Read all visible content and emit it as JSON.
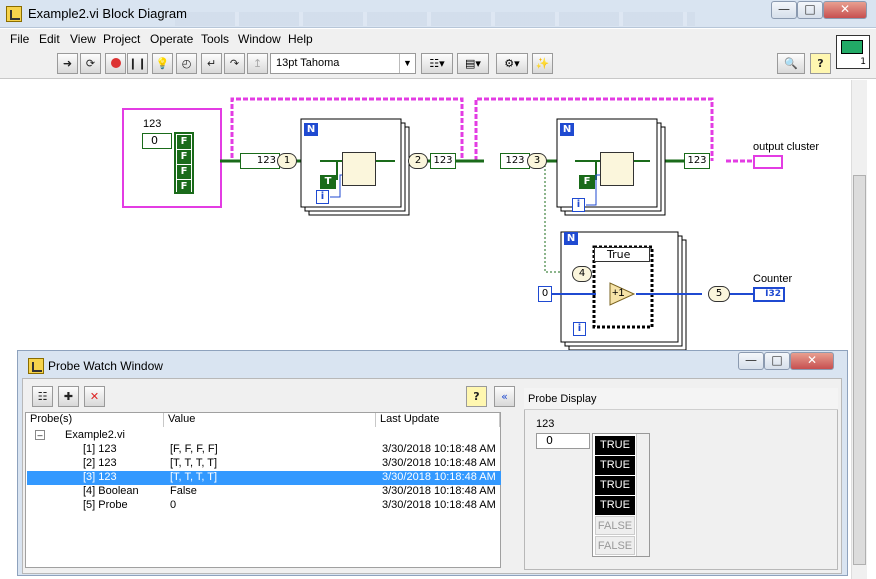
{
  "window": {
    "title": "Example2.vi Block Diagram"
  },
  "menu": [
    "File",
    "Edit",
    "View",
    "Project",
    "Operate",
    "Tools",
    "Window",
    "Help"
  ],
  "toolbar": {
    "font": "13pt Tahoma"
  },
  "diagram": {
    "array_label": "123",
    "array_index": "0",
    "array_elements": [
      "F",
      "F",
      "F",
      "F"
    ],
    "loop1": {
      "count_label": "N",
      "tunnel_value": "123",
      "shift_label": "1",
      "out_label": "2",
      "bool_const": "T",
      "iter": "i"
    },
    "loop2": {
      "count_label": "N",
      "tunnel_value": "123",
      "shift_label": "3",
      "bool_const": "F",
      "iter": "i"
    },
    "loop3": {
      "count_label": "N",
      "probe_label": "4",
      "case_selector": "True",
      "init": "0",
      "iter": "i",
      "out_label": "5"
    },
    "output_cluster_label": "output cluster",
    "counter_label": "Counter",
    "counter_type": "I32",
    "increment": "+1"
  },
  "probe_window": {
    "title": "Probe Watch Window",
    "columns": [
      "Probe(s)",
      "Value",
      "Last Update"
    ],
    "tree_root": "Example2.vi",
    "rows": [
      {
        "probe": "[1] 123",
        "value": "[F, F, F, F]",
        "time": "3/30/2018 10:18:48 AM",
        "selected": false
      },
      {
        "probe": "[2] 123",
        "value": "[T, T, T, T]",
        "time": "3/30/2018 10:18:48 AM",
        "selected": false
      },
      {
        "probe": "[3] 123",
        "value": "[T, T, T, T]",
        "time": "3/30/2018 10:18:48 AM",
        "selected": true
      },
      {
        "probe": "[4] Boolean",
        "value": "False",
        "time": "3/30/2018 10:18:48 AM",
        "selected": false
      },
      {
        "probe": "[5] Probe",
        "value": "0",
        "time": "3/30/2018 10:18:48 AM",
        "selected": false
      }
    ],
    "display": {
      "title": "Probe Display",
      "array_label": "123",
      "index": "0",
      "values": [
        "TRUE",
        "TRUE",
        "TRUE",
        "TRUE",
        "FALSE",
        "FALSE"
      ]
    }
  }
}
